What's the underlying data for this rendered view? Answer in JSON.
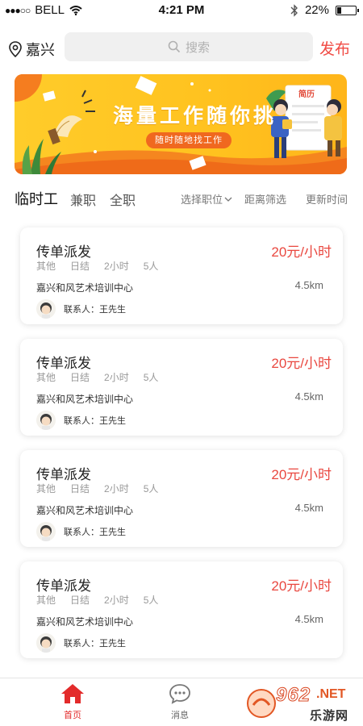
{
  "status_bar": {
    "carrier": "BELL",
    "time": "4:21 PM",
    "battery": "22%",
    "battery_level": 0.22
  },
  "header": {
    "city": "嘉兴",
    "search_placeholder": "搜索",
    "publish_label": "发布"
  },
  "banner": {
    "title": "海量工作随你挑",
    "subtitle": "随时随地找工作",
    "resume_label": "简历"
  },
  "tabs": [
    {
      "label": "临时工",
      "active": true
    },
    {
      "label": "兼职",
      "active": false
    },
    {
      "label": "全职",
      "active": false
    }
  ],
  "filters": {
    "position": "选择职位",
    "distance": "距离筛选",
    "update": "更新时间"
  },
  "jobs": [
    {
      "title": "传单派发",
      "salary": "20元/小时",
      "tags": [
        "其他",
        "日结",
        "2小时",
        "5人"
      ],
      "company": "嘉兴和风艺术培训中心",
      "distance": "4.5km",
      "contact": "联系人：王先生"
    },
    {
      "title": "传单派发",
      "salary": "20元/小时",
      "tags": [
        "其他",
        "日结",
        "2小时",
        "5人"
      ],
      "company": "嘉兴和风艺术培训中心",
      "distance": "4.5km",
      "contact": "联系人：王先生"
    },
    {
      "title": "传单派发",
      "salary": "20元/小时",
      "tags": [
        "其他",
        "日结",
        "2小时",
        "5人"
      ],
      "company": "嘉兴和风艺术培训中心",
      "distance": "4.5km",
      "contact": "联系人：王先生"
    },
    {
      "title": "传单派发",
      "salary": "20元/小时",
      "tags": [
        "其他",
        "日结",
        "2小时",
        "5人"
      ],
      "company": "嘉兴和风艺术培训中心",
      "distance": "4.5km",
      "contact": "联系人：王先生"
    }
  ],
  "bottom_nav": [
    {
      "label": "首页",
      "icon": "home-icon",
      "active": true
    },
    {
      "label": "消息",
      "icon": "message-icon",
      "active": false
    }
  ],
  "watermark": {
    "number": "962",
    "suffix": ".NET",
    "text": "乐游网"
  },
  "colors": {
    "accent": "#f04a43",
    "salary": "#e9473f",
    "banner": "#ffc21f",
    "nav_active": "#e32b2b"
  }
}
